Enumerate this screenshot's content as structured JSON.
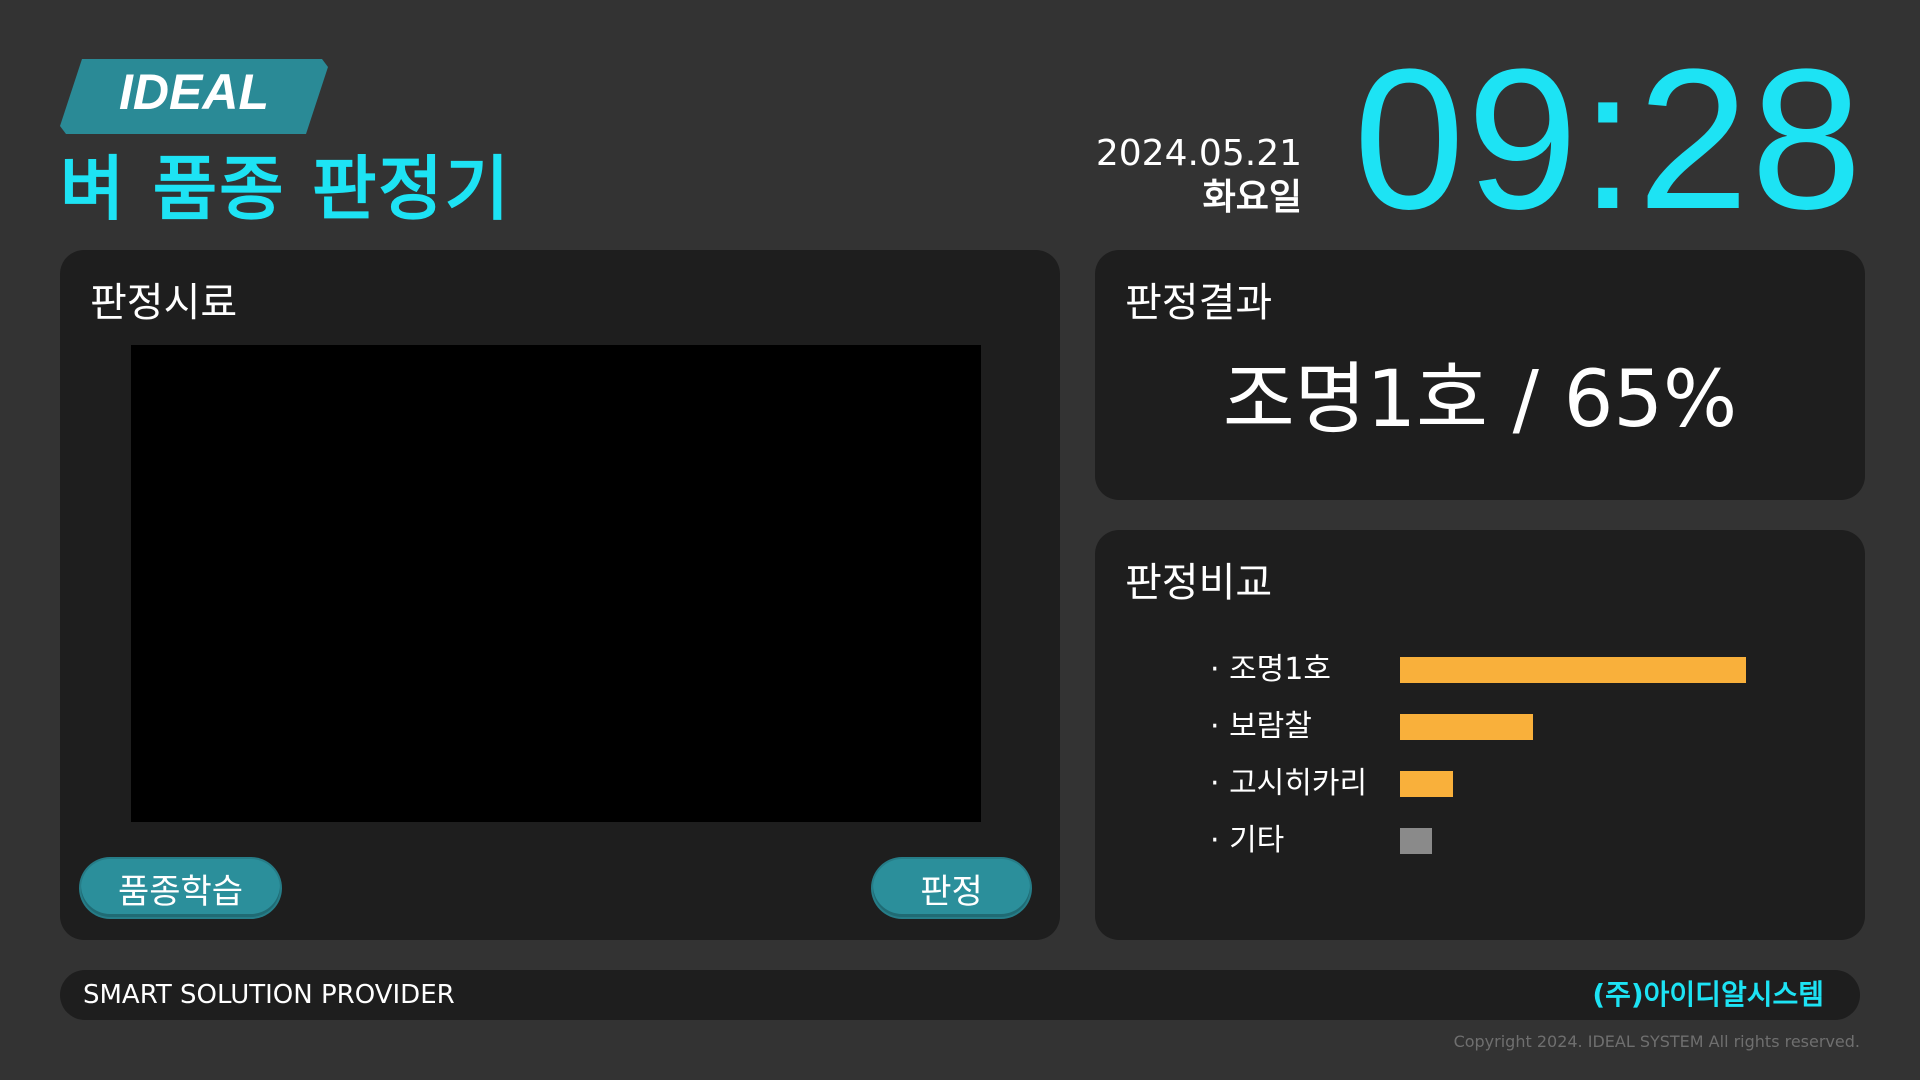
{
  "header": {
    "logo_text": "IDEAL",
    "app_title": "벼 품종 판정기",
    "date": "2024.05.21",
    "weekday": "화요일",
    "time": "09:28"
  },
  "sample_panel": {
    "title": "판정시료",
    "learn_button": "품종학습",
    "judge_button": "판정"
  },
  "result_panel": {
    "title": "판정결과",
    "result": "조명1호 / 65%"
  },
  "compare_panel": {
    "title": "판정비교",
    "items": [
      {
        "label": "· 조명1호",
        "value": 65,
        "color": "#f9b03b"
      },
      {
        "label": "· 보람찰",
        "value": 25,
        "color": "#f9b03b"
      },
      {
        "label": "· 고시히카리",
        "value": 10,
        "color": "#f9b03b"
      },
      {
        "label": "· 기타",
        "value": 6,
        "color": "#8a8a8a"
      }
    ]
  },
  "footer": {
    "left": "SMART SOLUTION PROVIDER",
    "right": "(주)아이디알시스템",
    "copyright": "Copyright 2024. IDEAL SYSTEM All rights reserved."
  },
  "colors": {
    "accent": "#1de3f4",
    "button": "#2b8f9b",
    "bar": "#f9b03b",
    "bar_other": "#8a8a8a",
    "panel": "#1e1e1e",
    "background": "#333333"
  }
}
